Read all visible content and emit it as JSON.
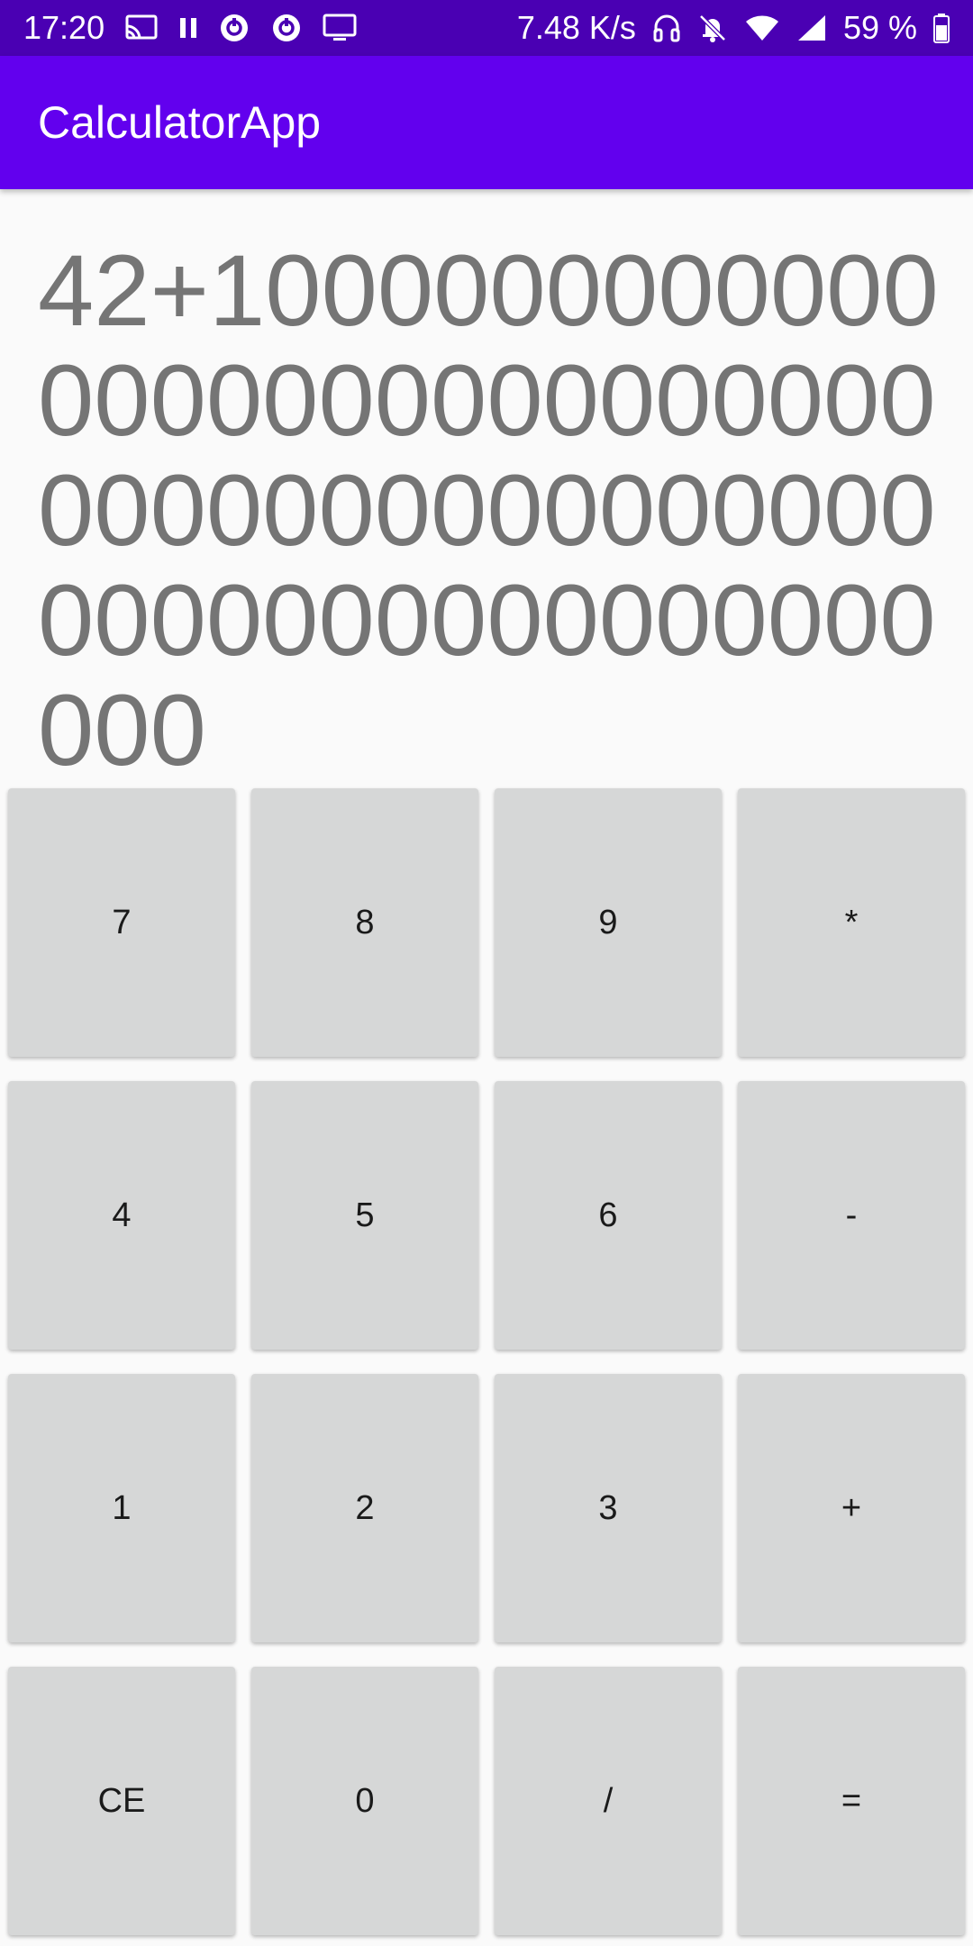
{
  "status_bar": {
    "time": "17:20",
    "network_speed": "7.48 K/s",
    "battery": "59 %",
    "icons_left": [
      "cast-icon",
      "pause-icon",
      "sync-icon",
      "sync-icon",
      "monitor-icon"
    ],
    "icons_right": [
      "headset-icon",
      "bell-off-icon",
      "wifi-icon",
      "signal-icon",
      "battery-icon"
    ]
  },
  "app_bar": {
    "title": "CalculatorApp"
  },
  "display": {
    "expression": "42+1000000000000000000000000000000000000000000000000000000000000000"
  },
  "keypad": {
    "keys": [
      "7",
      "8",
      "9",
      "*",
      "4",
      "5",
      "6",
      "-",
      "1",
      "2",
      "3",
      "+",
      "CE",
      "0",
      "/",
      "="
    ]
  },
  "colors": {
    "status_bar": "#4a00b3",
    "app_bar": "#6200ee",
    "key_background": "#d6d7d7",
    "display_text": "#757575"
  }
}
